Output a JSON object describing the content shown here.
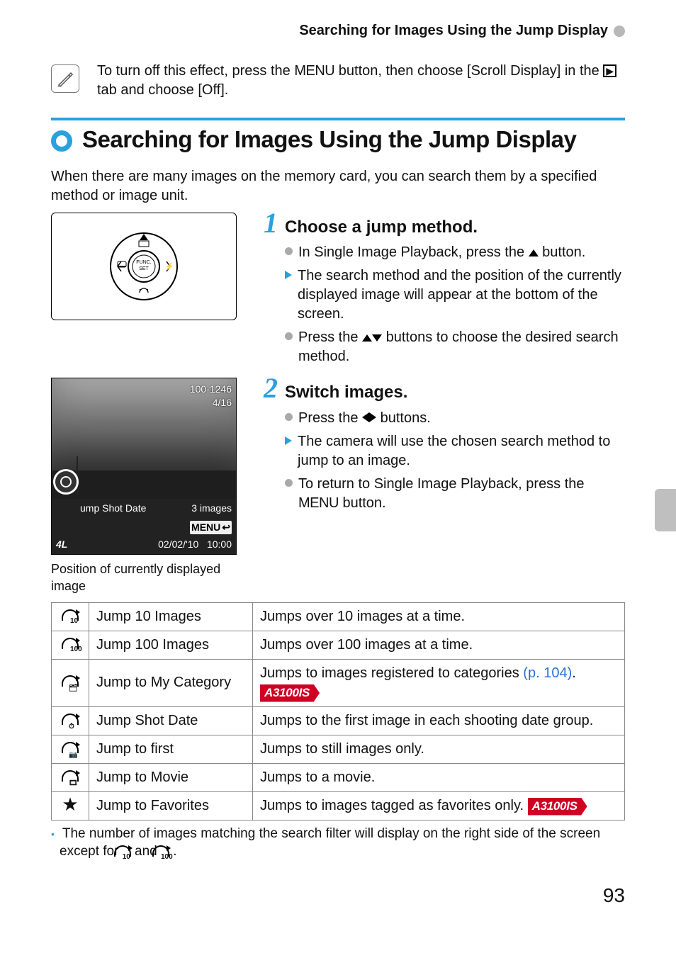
{
  "running_head": "Searching for Images Using the Jump Display",
  "tip": {
    "text_before_menu": "To turn off this effect, press the ",
    "menu_word": "MENU",
    "text_after_menu": " button, then choose [Scroll Display] in the ",
    "text_after_tab": " tab and choose [Off]."
  },
  "heading": "Searching for Images Using the Jump Display",
  "intro": "When there are many images on the memory card, you can search them by a specified method or image unit.",
  "step1": {
    "num": "1",
    "title": "Choose a jump method.",
    "b1a": "In Single Image Playback, press the ",
    "b1b": " button.",
    "b2": "The search method and the position of the currently displayed image will appear at the bottom of the screen.",
    "b3a": "Press the ",
    "b3b": " buttons to choose the desired search method."
  },
  "step2": {
    "num": "2",
    "title": "Switch images.",
    "b1a": "Press the ",
    "b1b": " buttons.",
    "b2": "The camera will use the chosen search method to jump to an image.",
    "b3a": "To return to Single Image Playback, press the ",
    "b3_menu": "MENU",
    "b3b": " button."
  },
  "screenshot": {
    "folder": "100-1246",
    "position": "4/16",
    "mode_label": "ump Shot Date",
    "count": "3 images",
    "menu_label": "MENU",
    "date": "02/02/'10",
    "time": "10:00",
    "size": "4L"
  },
  "caption": "Position of currently displayed image",
  "table": [
    {
      "icon_sub": "10",
      "name": "Jump 10 Images",
      "desc": "Jumps over 10 images at a time."
    },
    {
      "icon_sub": "100",
      "name": "Jump 100 Images",
      "desc": "Jumps over 100 images at a time."
    },
    {
      "icon_sub": "cat",
      "name": "Jump to My Category",
      "desc_pre": "Jumps to images registered to categories ",
      "link": "(p. 104)",
      "desc_post": ". ",
      "badge": "A3100IS"
    },
    {
      "icon_sub": "date",
      "name": "Jump Shot Date",
      "desc": "Jumps to the first image in each shooting date group."
    },
    {
      "icon_sub": "still",
      "name": "Jump to first",
      "desc": "Jumps to still images only."
    },
    {
      "icon_sub": "movie",
      "name": "Jump to Movie",
      "desc": "Jumps to a movie."
    },
    {
      "icon_sub": "star",
      "name": "Jump to Favorites",
      "desc_pre": "Jumps to images tagged as favorites only. ",
      "badge": "A3100IS"
    }
  ],
  "footnote": {
    "a": "The number of images matching the search filter will display on the right side of the screen except for ",
    "b": " and ",
    "c": "."
  },
  "page_number": "93"
}
